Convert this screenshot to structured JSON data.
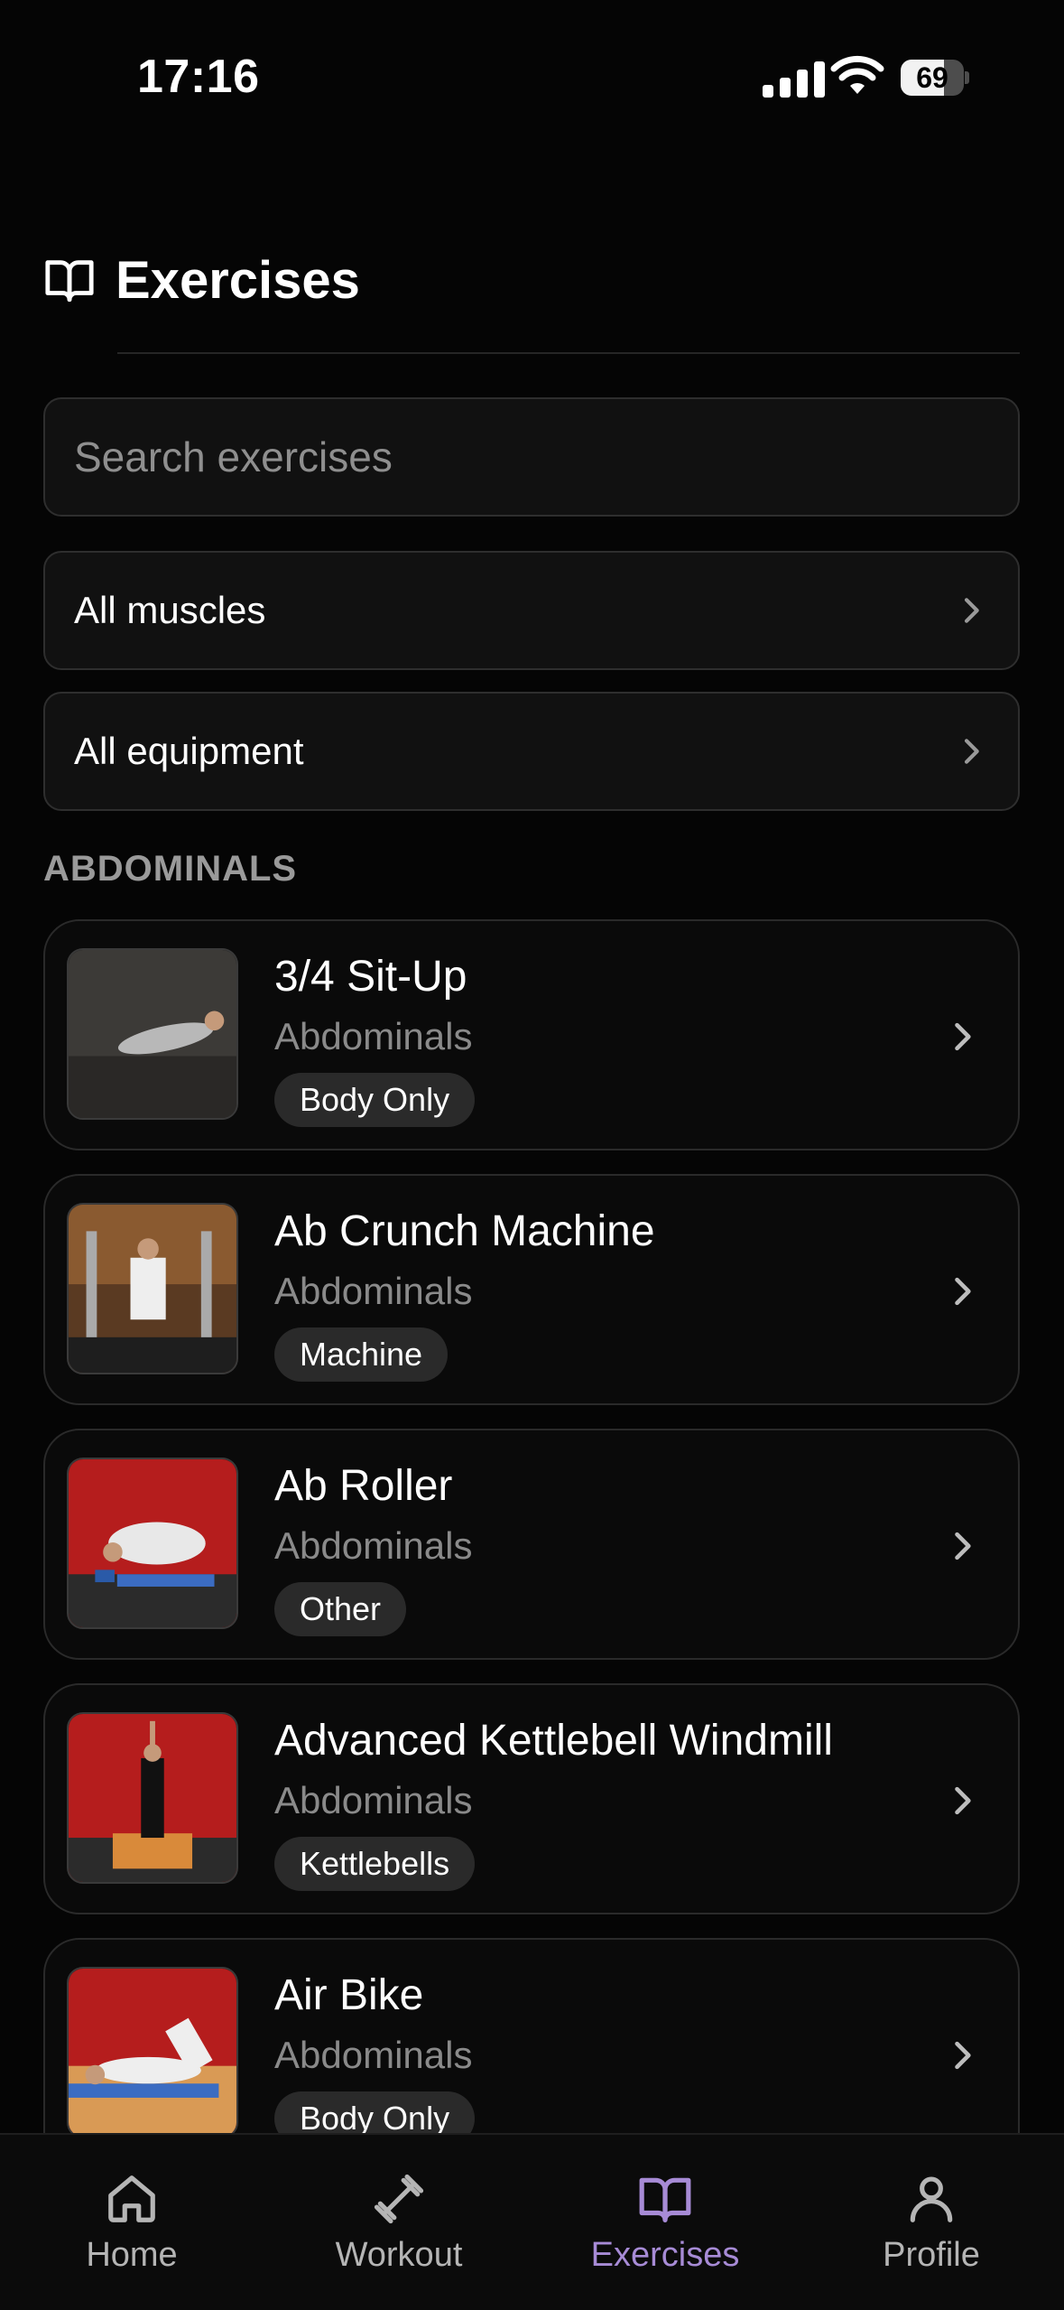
{
  "status_bar": {
    "time": "17:16",
    "battery": "69"
  },
  "header": {
    "title": "Exercises",
    "icon": "book-open-icon"
  },
  "search": {
    "placeholder": "Search exercises"
  },
  "filters": {
    "muscles": "All muscles",
    "equipment": "All equipment"
  },
  "section": {
    "title": "ABDOMINALS"
  },
  "exercises": [
    {
      "name": "3/4 Sit-Up",
      "muscle": "Abdominals",
      "equipment": "Body Only"
    },
    {
      "name": "Ab Crunch Machine",
      "muscle": "Abdominals",
      "equipment": "Machine"
    },
    {
      "name": "Ab Roller",
      "muscle": "Abdominals",
      "equipment": "Other"
    },
    {
      "name": "Advanced Kettlebell Windmill",
      "muscle": "Abdominals",
      "equipment": "Kettlebells"
    },
    {
      "name": "Air Bike",
      "muscle": "Abdominals",
      "equipment": "Body Only"
    }
  ],
  "tabs": [
    {
      "label": "Home",
      "icon": "home-icon"
    },
    {
      "label": "Workout",
      "icon": "dumbbell-icon"
    },
    {
      "label": "Exercises",
      "icon": "book-open-icon",
      "active": true
    },
    {
      "label": "Profile",
      "icon": "user-icon"
    }
  ],
  "colors": {
    "background": "#050505",
    "accent": "#a78bd6",
    "muted": "#8a8a8a"
  }
}
